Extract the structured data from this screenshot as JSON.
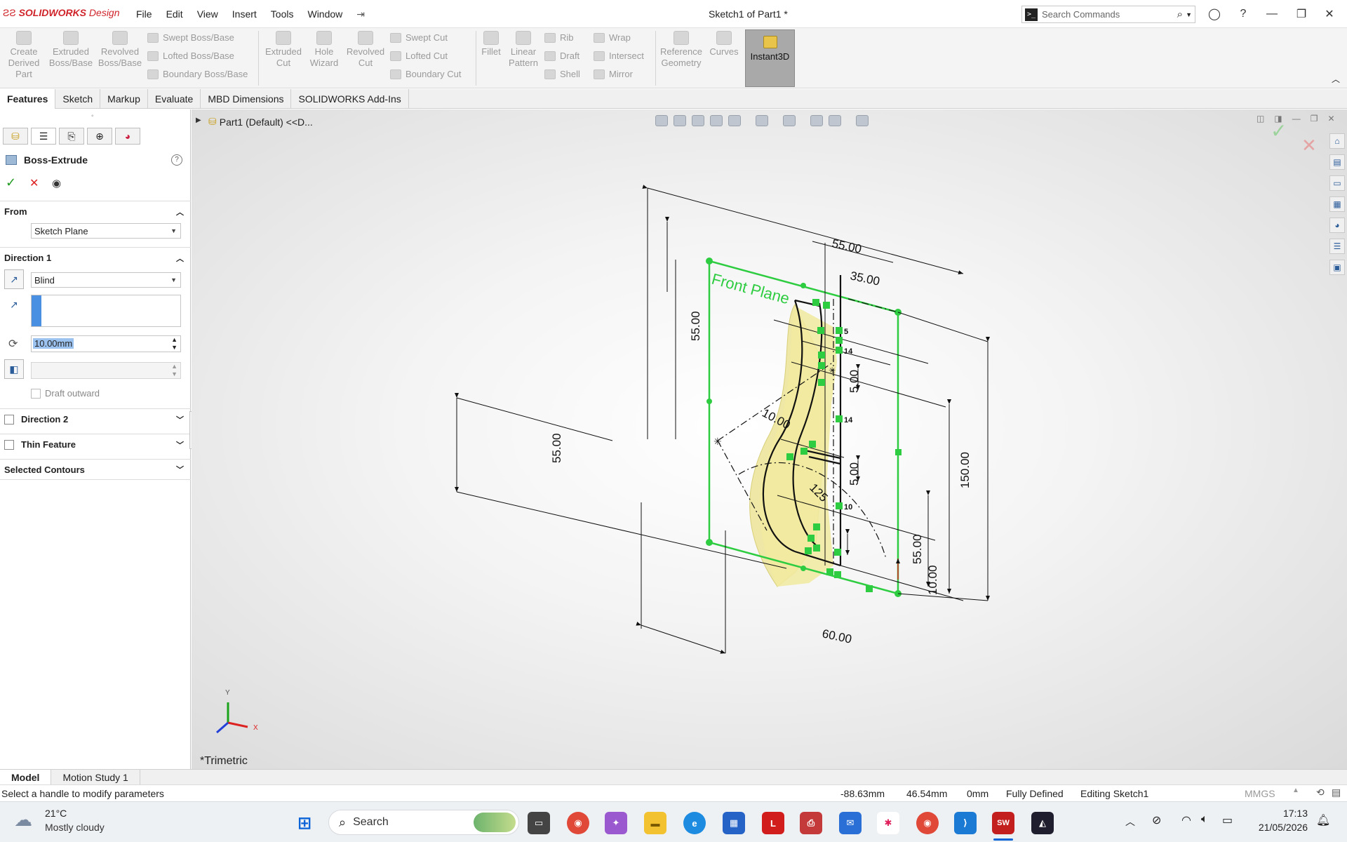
{
  "app": {
    "logo_brand": "SOLIDWORKS",
    "logo_suffix": "Design",
    "window_title": "Sketch1 of Part1 *",
    "menu": [
      "File",
      "Edit",
      "View",
      "Insert",
      "Tools",
      "Window"
    ],
    "search_placeholder": "Search Commands"
  },
  "toolbar": {
    "create_derived": "Create Derived Part",
    "extruded_boss": "Extruded Boss/Base",
    "revolved_boss": "Revolved Boss/Base",
    "swept_boss": "Swept Boss/Base",
    "lofted_boss": "Lofted Boss/Base",
    "boundary_boss": "Boundary Boss/Base",
    "extruded_cut": "Extruded Cut",
    "hole_wizard": "Hole Wizard",
    "revolved_cut": "Revolved Cut",
    "swept_cut": "Swept Cut",
    "lofted_cut": "Lofted Cut",
    "boundary_cut": "Boundary Cut",
    "fillet": "Fillet",
    "linear_pattern": "Linear Pattern",
    "rib": "Rib",
    "draft": "Draft",
    "shell": "Shell",
    "wrap": "Wrap",
    "intersect": "Intersect",
    "mirror": "Mirror",
    "reference_geometry": "Reference Geometry",
    "curves": "Curves",
    "instant3d": "Instant3D"
  },
  "tabs": [
    "Features",
    "Sketch",
    "Markup",
    "Evaluate",
    "MBD Dimensions",
    "SOLIDWORKS Add-Ins"
  ],
  "feature_panel": {
    "title": "Boss-Extrude",
    "from_label": "From",
    "from_value": "Sketch Plane",
    "direction1_label": "Direction 1",
    "end_condition": "Blind",
    "depth": "10.00mm",
    "draft_outward": "Draft outward",
    "direction2_label": "Direction 2",
    "thin_feature_label": "Thin Feature",
    "selected_contours_label": "Selected Contours"
  },
  "viewport": {
    "tree_item": "Part1 (Default) <<D...",
    "view_name": "*Trimetric",
    "plane_label": "Front Plane",
    "triad": {
      "x": "X",
      "y": "Y"
    },
    "dimensions": {
      "d_top_55": "55.00",
      "d_top_35": "35.00",
      "d_left_55_upper": "55.00",
      "d_left_55_lower": "55.00",
      "d_10": "10.00",
      "d_5_upper": "5.00",
      "d_5_lower": "5.00",
      "d_150": "150.00",
      "d_right_55": "55.00",
      "d_right_10": "10.00",
      "d_60": "60.00",
      "d_125": "125"
    },
    "relations": [
      "5",
      "14",
      "14",
      "10"
    ]
  },
  "bottom_tabs": [
    "Model",
    "Motion Study 1"
  ],
  "status": {
    "message": "Select a handle to modify parameters",
    "x": "-88.63mm",
    "y": "46.54mm",
    "z": "0mm",
    "state": "Fully Defined",
    "mode": "Editing Sketch1",
    "units": "MMGS"
  },
  "taskbar": {
    "weather_temp": "21°C",
    "weather_desc": "Mostly cloudy",
    "search_label": "Search",
    "time": "17:13",
    "date": "21/05/2026"
  }
}
